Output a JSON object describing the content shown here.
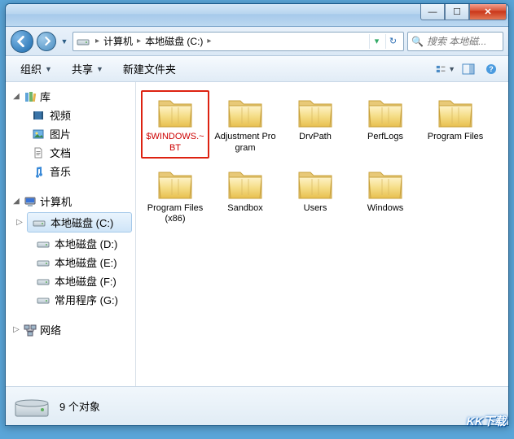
{
  "titlebar": {
    "min": "—",
    "max": "☐",
    "close": "✕"
  },
  "address": {
    "crumbs": [
      "计算机",
      "本地磁盘 (C:)"
    ],
    "refresh_title": "刷新"
  },
  "search": {
    "placeholder": "搜索 本地磁..."
  },
  "toolbar": {
    "organize": "组织",
    "share": "共享",
    "newfolder": "新建文件夹"
  },
  "toolicons": {
    "view": "view-icon",
    "preview": "preview-icon",
    "help": "help-icon"
  },
  "sidebar": {
    "lib": "库",
    "lib_items": [
      "视频",
      "图片",
      "文档",
      "音乐"
    ],
    "computer": "计算机",
    "drives": [
      "本地磁盘 (C:)",
      "本地磁盘 (D:)",
      "本地磁盘 (E:)",
      "本地磁盘 (F:)",
      "常用程序 (G:)"
    ],
    "network": "网络"
  },
  "folders": [
    {
      "name": "$WINDOWS.~BT",
      "highlight": true
    },
    {
      "name": "Adjustment Program"
    },
    {
      "name": "DrvPath"
    },
    {
      "name": "PerfLogs"
    },
    {
      "name": "Program Files"
    },
    {
      "name": "Program Files (x86)"
    },
    {
      "name": "Sandbox"
    },
    {
      "name": "Users"
    },
    {
      "name": "Windows"
    }
  ],
  "status": {
    "count_label": "9 个对象"
  },
  "watermark": "KK下载"
}
